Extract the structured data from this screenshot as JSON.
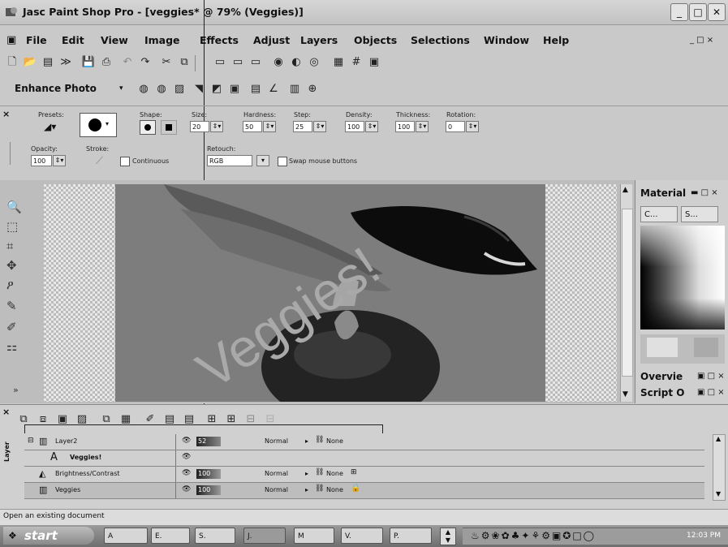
{
  "window": {
    "title": "Jasc Paint Shop Pro - [veggies* @ 79% (Veggies)]",
    "controls": [
      "_",
      "□",
      "✕"
    ]
  },
  "menu": {
    "items": [
      "File",
      "Edit",
      "View",
      "Image",
      "Effects",
      "Adjust",
      "Layers",
      "Objects",
      "Selections",
      "Window",
      "Help"
    ],
    "right": "_ □ ×"
  },
  "enhance_toolbar": {
    "label": "Enhance Photo"
  },
  "tool_options": {
    "presets_label": "Presets:",
    "shape_label": "Shape:",
    "size_label": "Size:",
    "size_value": "20",
    "hardness_label": "Hardness:",
    "hardness_value": "50",
    "step_label": "Step:",
    "step_value": "25",
    "density_label": "Density:",
    "density_value": "100",
    "thickness_label": "Thickness:",
    "thickness_value": "100",
    "rotation_label": "Rotation:",
    "rotation_value": "0",
    "opacity_label": "Opacity:",
    "opacity_value": "100",
    "stroke_label": "Stroke:",
    "continuous_label": "Continuous",
    "retouch_label": "Retouch:",
    "retouch_value": "RGB",
    "swap_label": "Swap mouse buttons"
  },
  "canvas": {
    "text": "Veggies!"
  },
  "palettes": {
    "material_title": "Material",
    "material_tabs": [
      "C...",
      "S..."
    ],
    "overview_title": "Overvie",
    "script_title": "Script O"
  },
  "layers": {
    "tab_label": "Layer",
    "rows": [
      {
        "name": "Layer2",
        "opacity": "52",
        "blend": "Normal",
        "mask": "None"
      },
      {
        "name": "Veggies!",
        "opacity": "",
        "blend": "",
        "mask": ""
      },
      {
        "name": "Brightness/Contrast",
        "opacity": "100",
        "blend": "Normal",
        "mask": "None"
      },
      {
        "name": "Veggies",
        "opacity": "100",
        "blend": "Normal",
        "mask": "None"
      }
    ]
  },
  "status": {
    "text": "Open an existing document"
  },
  "taskbar": {
    "start_label": "start",
    "buttons": [
      "A",
      "E.",
      "S.",
      "J.",
      "M",
      "V.",
      "P."
    ],
    "clock": "12:03 PM"
  }
}
